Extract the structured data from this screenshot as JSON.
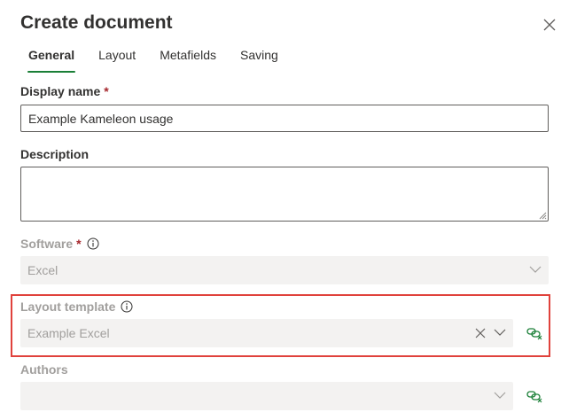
{
  "dialog": {
    "title": "Create document",
    "close_icon": "close-icon"
  },
  "tabs": [
    {
      "label": "General",
      "active": true
    },
    {
      "label": "Layout",
      "active": false
    },
    {
      "label": "Metafields",
      "active": false
    },
    {
      "label": "Saving",
      "active": false
    }
  ],
  "display_name": {
    "label": "Display name",
    "required_mark": "*",
    "value": "Example Kameleon usage"
  },
  "description": {
    "label": "Description",
    "value": ""
  },
  "software": {
    "label": "Software",
    "required_mark": "*",
    "value": "Excel",
    "disabled": true
  },
  "layout_template": {
    "label": "Layout template",
    "value": "Example Excel",
    "disabled": true
  },
  "authors": {
    "label": "Authors",
    "value": "",
    "disabled": true
  },
  "colors": {
    "accent": "#1a7f37",
    "required": "#a4262c",
    "highlight": "#e0423c",
    "disabled_fill": "#f3f2f1",
    "disabled_text": "#a19f9d"
  }
}
